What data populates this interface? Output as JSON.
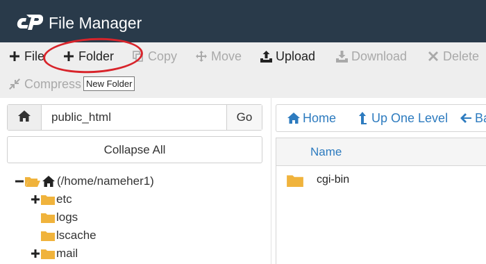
{
  "header": {
    "title": "File Manager",
    "logo_icon": "cpanel-logo-icon",
    "background": "#293a4a"
  },
  "toolbar": {
    "buttons": [
      {
        "label": "File",
        "icon": "plus-icon",
        "enabled": true
      },
      {
        "label": "Folder",
        "icon": "plus-icon",
        "enabled": true
      },
      {
        "label": "Copy",
        "icon": "copy-icon",
        "enabled": false
      },
      {
        "label": "Move",
        "icon": "move-arrows-icon",
        "enabled": false
      },
      {
        "label": "Upload",
        "icon": "upload-icon",
        "enabled": true
      },
      {
        "label": "Download",
        "icon": "download-icon",
        "enabled": false
      },
      {
        "label": "Delete",
        "icon": "x-icon",
        "enabled": false
      },
      {
        "label": "Compress",
        "icon": "compress-icon",
        "enabled": false
      }
    ],
    "tooltip": "New Folder",
    "highlight_color": "#d8242b"
  },
  "left_panel": {
    "path_value": "public_html",
    "go_label": "Go",
    "collapse_label": "Collapse All",
    "tree": [
      {
        "label": "(/home/nameher1)",
        "toggle": "minus",
        "type": "home-root"
      },
      {
        "label": "etc",
        "toggle": "plus",
        "type": "folder"
      },
      {
        "label": "logs",
        "toggle": "",
        "type": "folder"
      },
      {
        "label": "lscache",
        "toggle": "",
        "type": "folder"
      },
      {
        "label": "mail",
        "toggle": "plus",
        "type": "folder"
      }
    ]
  },
  "right_panel": {
    "nav": [
      {
        "label": "Home",
        "icon": "home-icon"
      },
      {
        "label": "Up One Level",
        "icon": "level-up-icon"
      },
      {
        "label": "Ba",
        "icon": "arrow-left-icon"
      }
    ],
    "column_header": "Name",
    "files": [
      {
        "name": "cgi-bin",
        "type": "folder"
      }
    ],
    "link_color": "#2d7bbf",
    "folder_color": "#f0b33c"
  }
}
